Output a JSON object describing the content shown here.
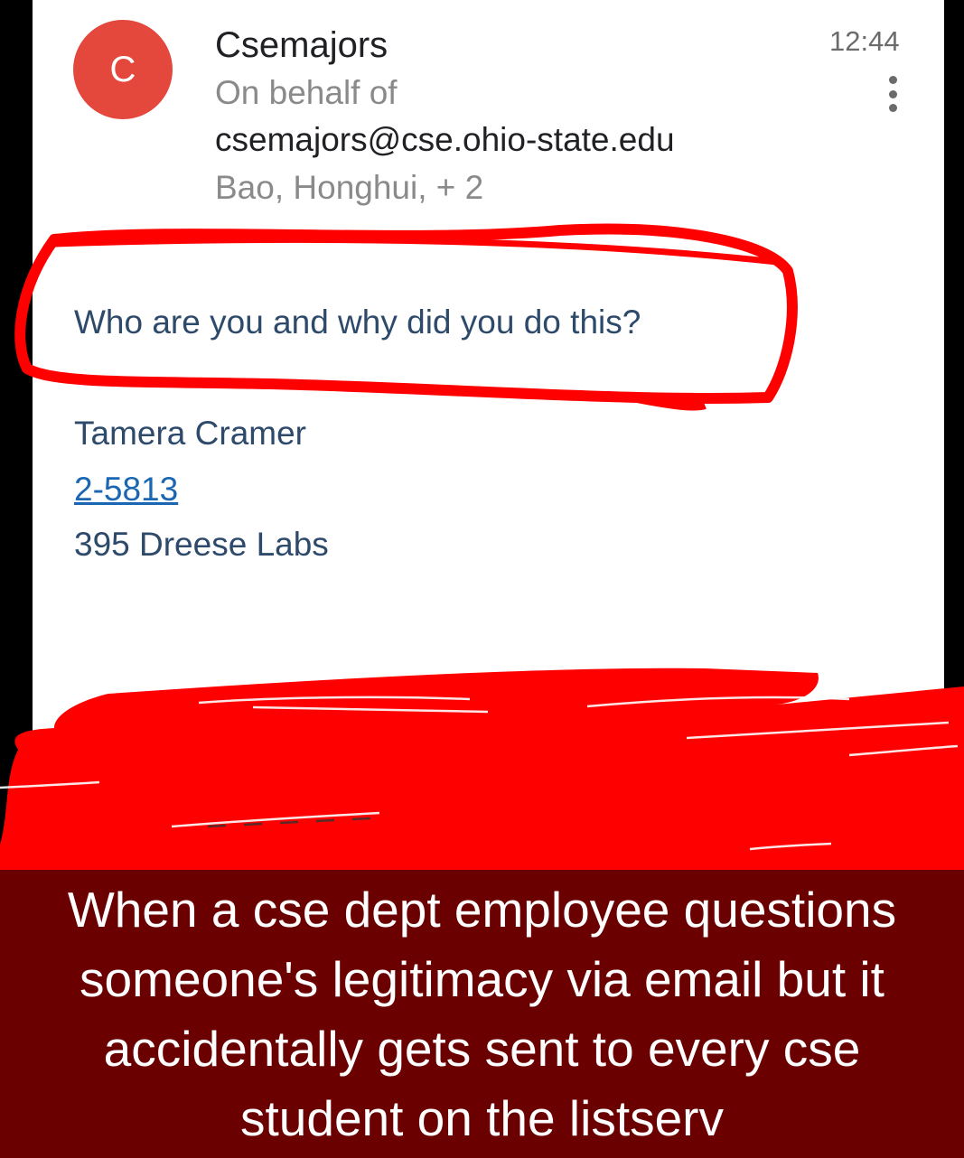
{
  "email": {
    "avatar_letter": "C",
    "avatar_color": "#e4473c",
    "sender": "Csemajors",
    "on_behalf_label": "On behalf of",
    "sender_address": "csemajors@cse.ohio-state.edu",
    "recipients": "Bao, Honghui, + 2",
    "time": "12:44",
    "more_icon": "more-vert-icon",
    "body": {
      "question": "Who are you and why did you do this?",
      "signature_name": "Tamera Cramer",
      "signature_phone": "2-5813",
      "signature_office": "395 Dreese Labs"
    }
  },
  "meme": {
    "caption": "When a cse dept employee questions someone's legitimacy via email but it accidentally gets sent to every cse student on the listserv",
    "caption_bg": "#6b0000",
    "highlight_color": "#ff0000"
  }
}
